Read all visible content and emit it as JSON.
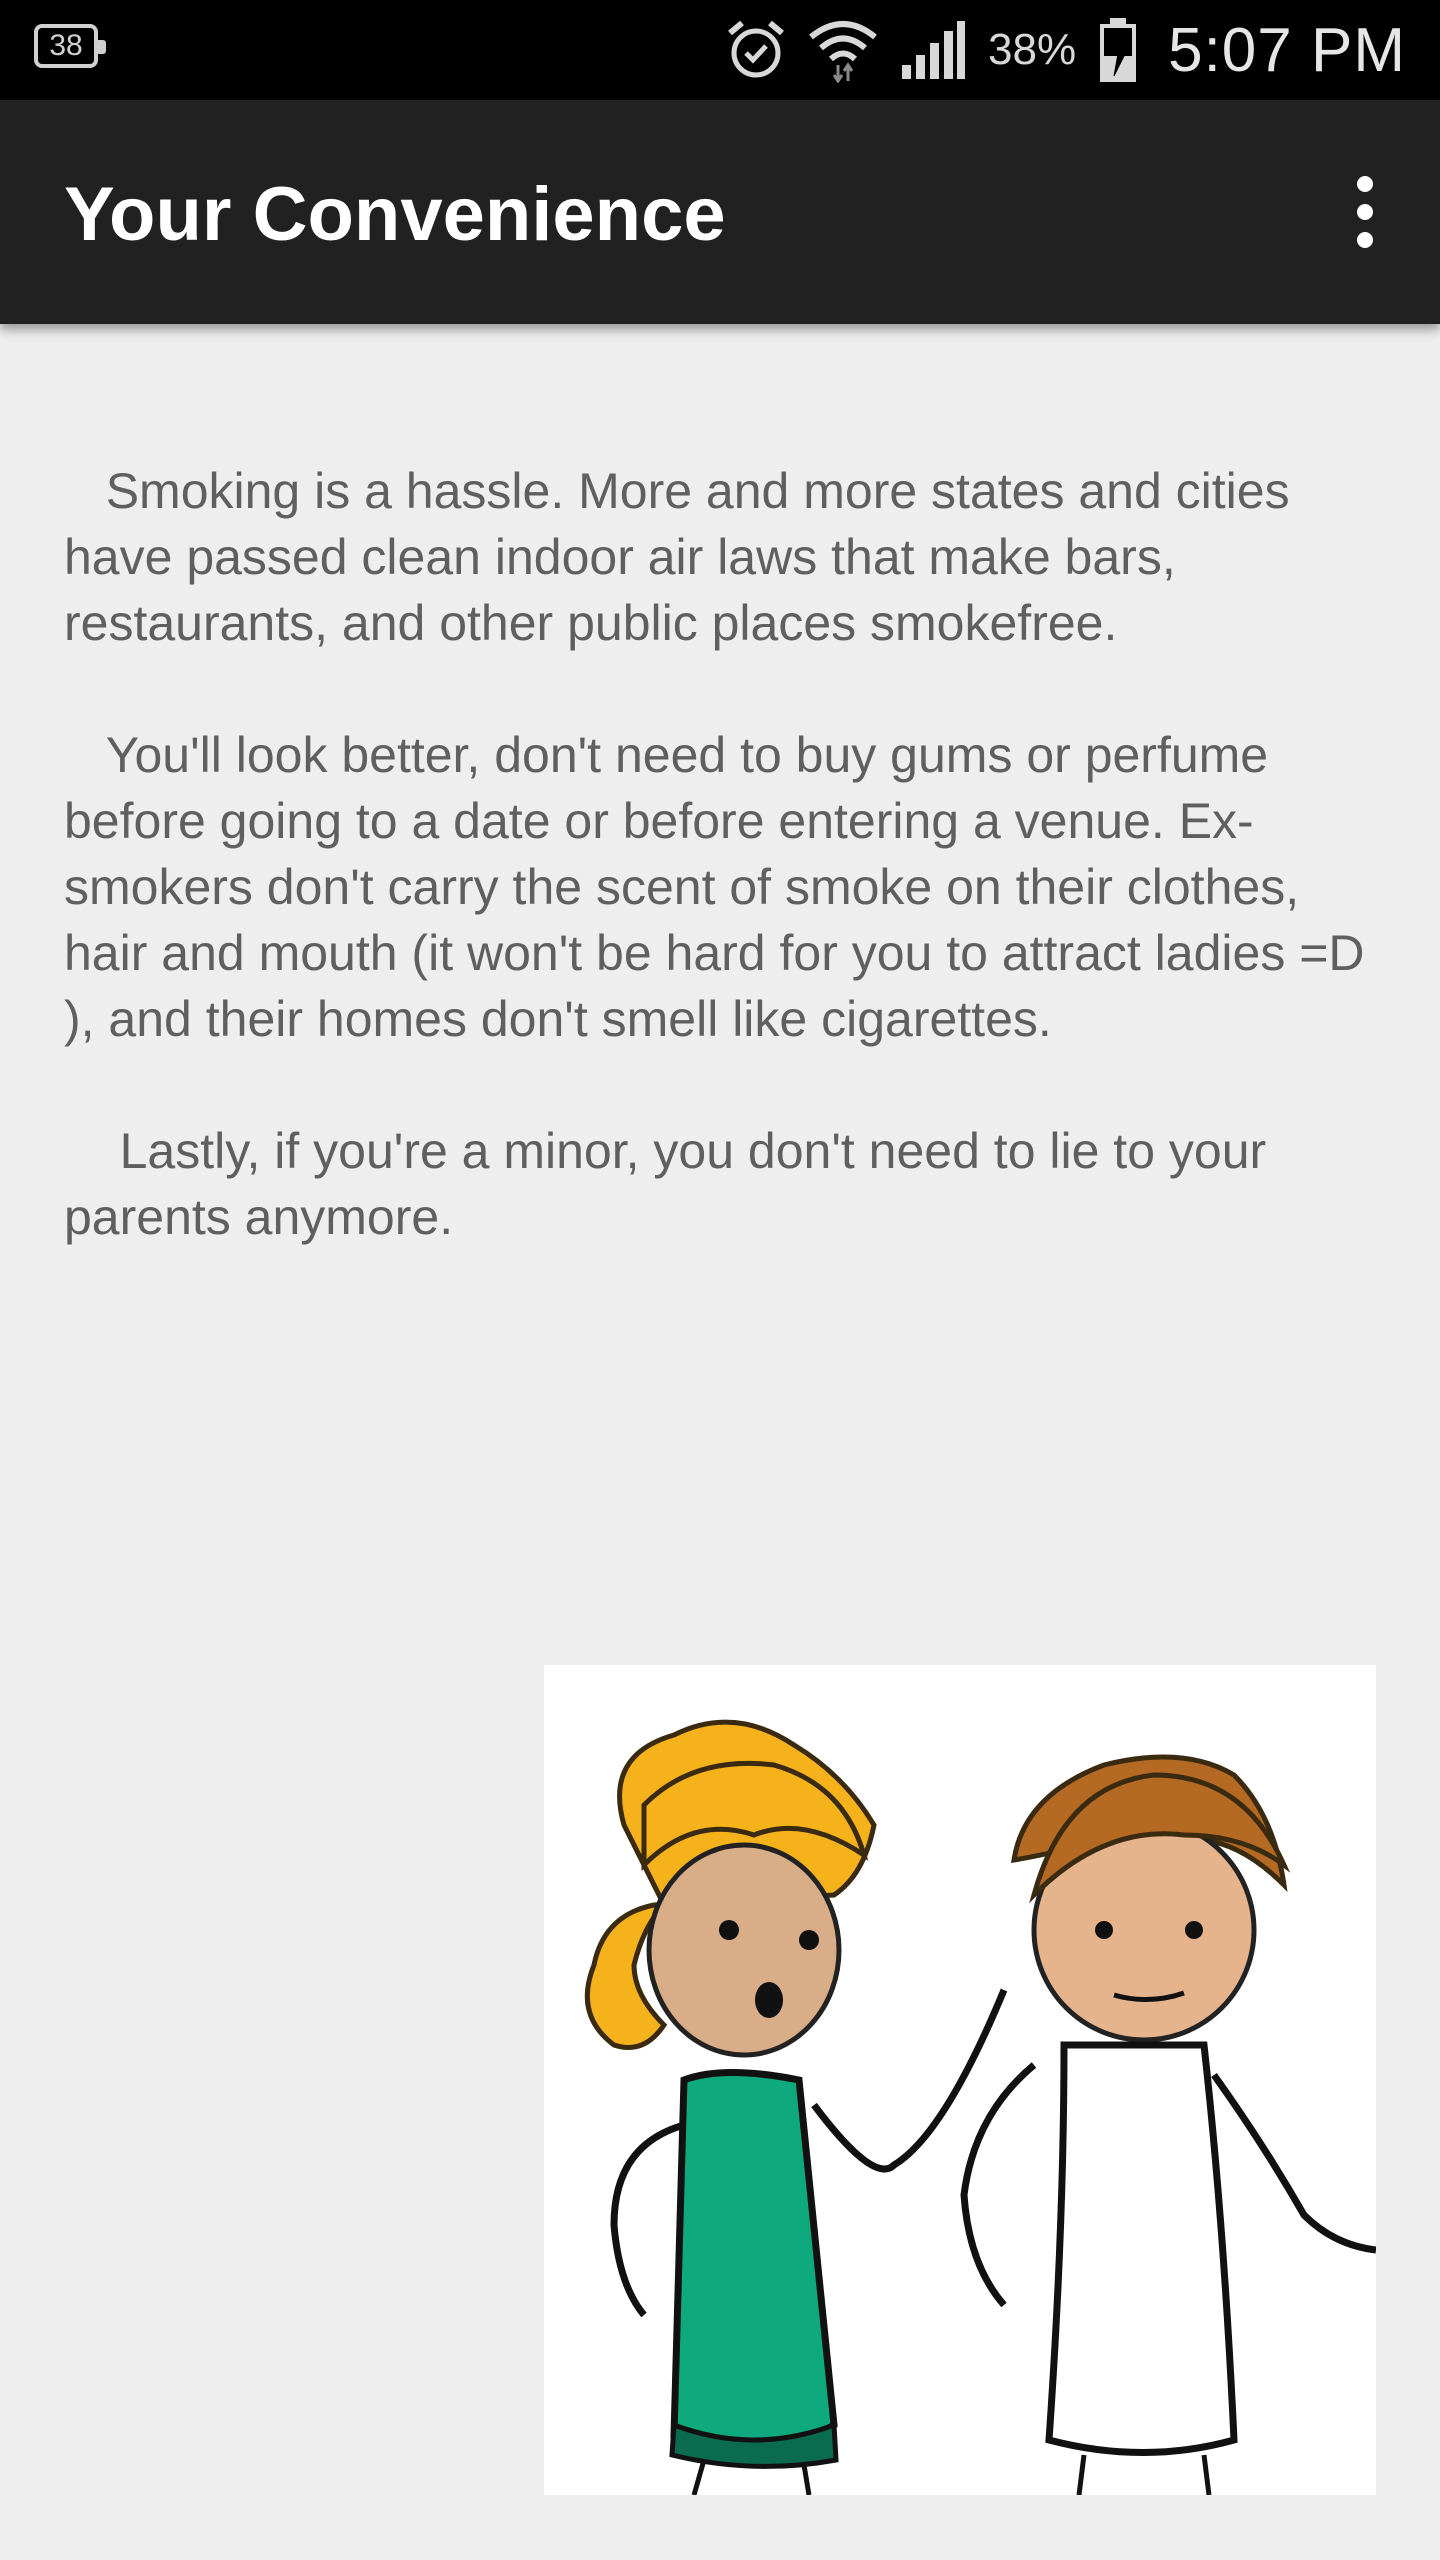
{
  "status_bar": {
    "notification_count": "38",
    "battery_percent": "38%",
    "time": "5:07 PM",
    "icons": [
      "alarm-icon",
      "wifi-icon",
      "signal-icon",
      "battery-charging-icon"
    ]
  },
  "app_bar": {
    "title": "Your Convenience",
    "menu_icon": "overflow-menu-icon"
  },
  "content": {
    "paragraph_1": "   Smoking is a hassle. More and more states and cities have passed clean indoor air laws that make bars, restaurants, and other public places smokefree.",
    "paragraph_2": "   You'll look better, don't need to buy gums or perfume before going to a date or before entering a venue. Ex-smokers don't carry the scent of smoke on their clothes, hair and mouth (it won't be hard for you to attract ladies =D ), and their homes don't smell like cigarettes.",
    "paragraph_3": "    Lastly, if you're a minor, you don't need to lie to your parents anymore."
  },
  "illustration": {
    "icon": "couple-cartoon-image"
  },
  "colors": {
    "status_bar_bg": "#000000",
    "app_bar_bg": "#212121",
    "page_bg": "#eeeeee",
    "text": "#5f5f5f"
  }
}
